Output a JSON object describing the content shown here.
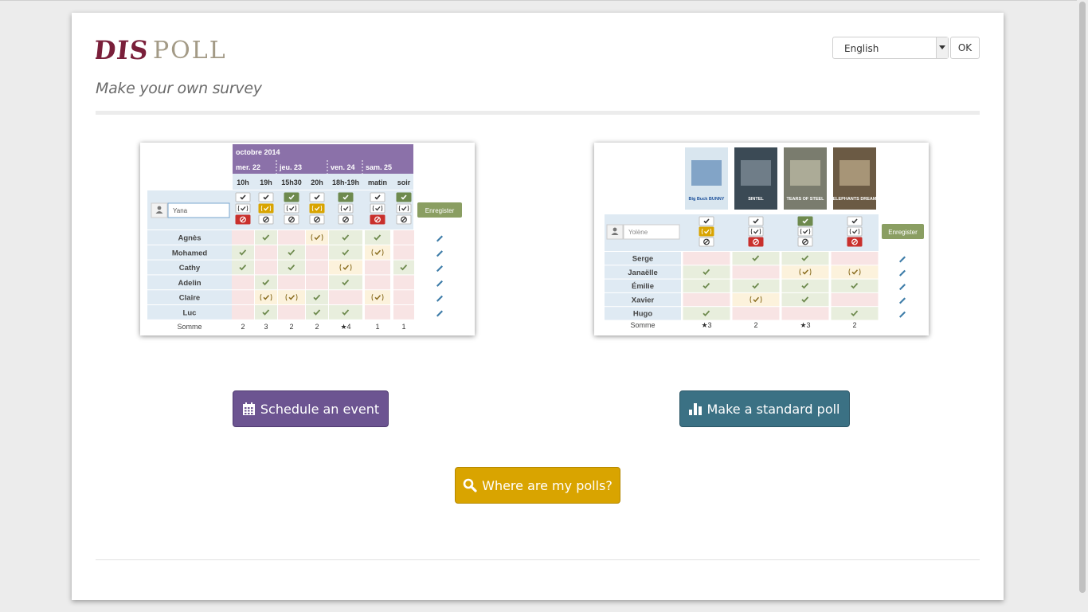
{
  "header": {
    "logo_text": "DISPOLL",
    "tagline": "Make your own survey",
    "language": {
      "selected": "English",
      "ok_label": "OK"
    }
  },
  "colors": {
    "event": "#6c5491",
    "poll": "#3b7184",
    "where": "#d9a400",
    "yes": "#6e8a4e",
    "maybe": "#d9a400",
    "no": "#c9302c",
    "logo_dark": "#7a1f3a",
    "logo_light": "#a39a86"
  },
  "date_example": {
    "month": "octobre 2014",
    "days": [
      {
        "label": "mer. 22",
        "span": 2
      },
      {
        "label": "jeu. 23",
        "span": 2
      },
      {
        "label": "ven. 24",
        "span": 1
      },
      {
        "label": "sam. 25",
        "span": 2
      }
    ],
    "hours": [
      "10h",
      "19h",
      "15h30",
      "20h",
      "18h-19h",
      "matin",
      "soir"
    ],
    "input_value": "Yana",
    "choice_rows": [
      [
        "yes-off",
        "yes-off",
        "yes-on",
        "yes-off",
        "yes-on",
        "yes-off",
        "yes-on"
      ],
      [
        "maybe-off",
        "maybe-on",
        "maybe-off",
        "maybe-on",
        "maybe-off",
        "maybe-off",
        "maybe-off"
      ],
      [
        "no-on",
        "no-off",
        "no-off",
        "no-off",
        "no-off",
        "no-on",
        "no-off"
      ]
    ],
    "save_label": "Enregister",
    "participants": [
      {
        "name": "Agnès",
        "votes": [
          "n",
          "y",
          "n",
          "m",
          "y",
          "y",
          "n"
        ]
      },
      {
        "name": "Mohamed",
        "votes": [
          "y",
          "n",
          "y",
          "n",
          "y",
          "m",
          "n"
        ]
      },
      {
        "name": "Cathy",
        "votes": [
          "y",
          "n",
          "y",
          "n",
          "m",
          "n",
          "y"
        ]
      },
      {
        "name": "Adelin",
        "votes": [
          "n",
          "y",
          "n",
          "n",
          "y",
          "n",
          "n"
        ]
      },
      {
        "name": "Claire",
        "votes": [
          "n",
          "m",
          "m",
          "y",
          "n",
          "m",
          "n"
        ]
      },
      {
        "name": "Luc",
        "votes": [
          "n",
          "y",
          "n",
          "y",
          "y",
          "n",
          "n"
        ]
      }
    ],
    "sum_label": "Somme",
    "sums": [
      "2",
      "3",
      "2",
      "2",
      "★4",
      "1",
      "1"
    ]
  },
  "poll_example": {
    "posters": [
      "Big Buck BUNNY",
      "SINTEL",
      "TEARS OF STEEL",
      "ELEPHANTS DREAM"
    ],
    "input_value": "Yolène",
    "choice_rows": [
      [
        "yes-off",
        "yes-off",
        "yes-on",
        "yes-off"
      ],
      [
        "maybe-on",
        "maybe-off",
        "maybe-off",
        "maybe-off"
      ],
      [
        "no-off",
        "no-on",
        "no-off",
        "no-on"
      ]
    ],
    "save_label": "Enregister",
    "participants": [
      {
        "name": "Serge",
        "votes": [
          "n",
          "y",
          "y",
          "n"
        ]
      },
      {
        "name": "Janaëlle",
        "votes": [
          "y",
          "n",
          "m",
          "m"
        ]
      },
      {
        "name": "Émilie",
        "votes": [
          "y",
          "y",
          "y",
          "y"
        ]
      },
      {
        "name": "Xavier",
        "votes": [
          "n",
          "m",
          "y",
          "n"
        ]
      },
      {
        "name": "Hugo",
        "votes": [
          "y",
          "n",
          "n",
          "y"
        ]
      }
    ],
    "sum_label": "Somme",
    "sums": [
      "★3",
      "2",
      "★3",
      "2"
    ]
  },
  "actions": {
    "schedule_event": "Schedule an event",
    "standard_poll": "Make a standard poll",
    "where_polls": "Where are my polls?"
  }
}
